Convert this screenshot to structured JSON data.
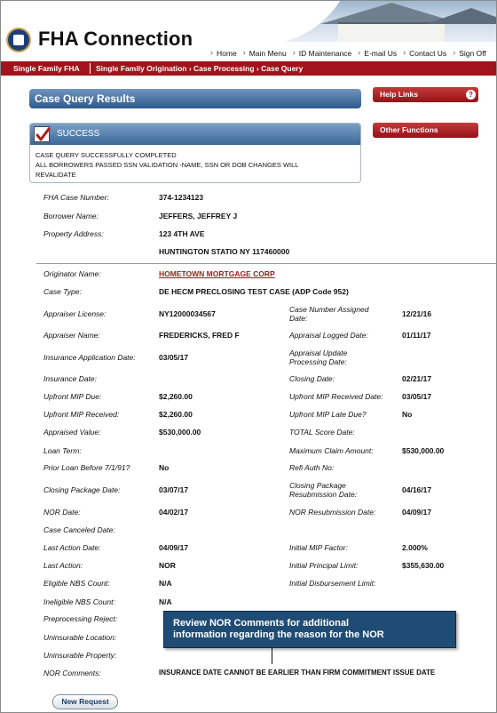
{
  "header": {
    "brand": "FHA Connection",
    "nav": [
      "Home",
      "Main Menu",
      "ID Maintenance",
      "E-mail Us",
      "Contact Us",
      "Sign Off"
    ]
  },
  "redbar": {
    "section": "Single Family FHA",
    "breadcrumb": "Single Family Origination › Case Processing › Case Query"
  },
  "page": {
    "title": "Case Query Results",
    "help_links": "Help Links",
    "help_icon": "?",
    "other_functions": "Other Functions"
  },
  "success": {
    "label": "SUCCESS",
    "line1": "CASE QUERY SUCCESSFULLY COMPLETED",
    "line2": "ALL BORROWERS PASSED SSN VALIDATION -NAME, SSN OR DOB CHANGES WILL",
    "line3": "REVALIDATE"
  },
  "case": {
    "fha_case_number_label": "FHA Case Number:",
    "fha_case_number": "374-1234123",
    "borrower_name_label": "Borrower Name:",
    "borrower_name": "JEFFERS, JEFFREY J",
    "property_address_label": "Property Address:",
    "property_address_1": "123 4TH AVE",
    "property_address_2": "HUNTINGTON STATIO NY 117460000"
  },
  "fields": {
    "originator_name_label": "Originator Name:",
    "originator_name": "HOMETOWN MORTGAGE CORP",
    "case_type_label": "Case Type:",
    "case_type": "DE HECM PRECLOSING TEST CASE (ADP Code 952)",
    "appraiser_license_label": "Appraiser License:",
    "appraiser_license": "NY12000034567",
    "case_number_assigned_label_1": "Case Number Assigned",
    "case_number_assigned_label_2": "Date:",
    "case_number_assigned": "12/21/16",
    "appraiser_name_label": "Appraiser Name:",
    "appraiser_name": "FREDERICKS, FRED F",
    "appraisal_logged_label": "Appraisal Logged Date:",
    "appraisal_logged": "01/11/17",
    "insurance_application_label": "Insurance Application Date:",
    "insurance_application": "03/05/17",
    "appraisal_update_label_1": "Appraisal Update",
    "appraisal_update_label_2": "Processing Date:",
    "insurance_date_label": "Insurance Date:",
    "closing_date_label": "Closing Date:",
    "closing_date": "02/21/17",
    "upfront_mip_due_label": "Upfront MIP Due:",
    "upfront_mip_due": "$2,260.00",
    "upfront_mip_received_date_label": "Upfront MIP Received Date:",
    "upfront_mip_received_date": "03/05/17",
    "upfront_mip_received_label": "Upfront MIP Received:",
    "upfront_mip_received": "$2,260.00",
    "upfront_mip_late_label": "Upfront MIP Late Due?",
    "upfront_mip_late": "No",
    "appraised_value_label": "Appraised Value:",
    "appraised_value": "$530,000.00",
    "total_score_label": "TOTAL Score Date:",
    "loan_term_label": "Loan Term:",
    "max_claim_label": "Maximum Claim Amount:",
    "max_claim": "$530,000.00",
    "prior_loan_label": "Prior Loan Before 7/1/91?",
    "prior_loan": "No",
    "refi_auth_label": "Refi Auth No:",
    "closing_package_label": "Closing Package Date:",
    "closing_package": "03/07/17",
    "closing_package_resub_label_1": "Closing Package",
    "closing_package_resub_label_2": "Resubmission Date:",
    "closing_package_resub": "04/16/17",
    "nor_date_label": "NOR Date:",
    "nor_date": "04/02/17",
    "nor_resub_label": "NOR Resubmission Date:",
    "nor_resub": "04/09/17",
    "case_canceled_label": "Case Canceled Date:",
    "last_action_date_label": "Last Action Date:",
    "last_action_date": "04/09/17",
    "initial_mip_factor_label": "Initial MIP Factor:",
    "initial_mip_factor": "2.000%",
    "last_action_label": "Last Action:",
    "last_action": "NOR",
    "initial_principal_label": "Initial Principal Limit:",
    "initial_principal": "$355,630.00",
    "eligible_nbs_label": "Eligible NBS Count:",
    "eligible_nbs": "N/A",
    "initial_disbursement_label": "Initial Disbursement Limit:",
    "ineligible_nbs_label": "Ineligible NBS Count:",
    "ineligible_nbs": "N/A",
    "preprocessing_reject_label": "Preprocessing Reject:",
    "uninsurable_location_label": "Uninsurable Location:",
    "uninsurable_property_label": "Uninsurable Property:",
    "nor_comments_label": "NOR Comments:",
    "nor_comments": "INSURANCE DATE CANNOT BE EARLIER THAN FIRM COMMITMENT ISSUE DATE"
  },
  "callout": {
    "line1": "Review NOR Comments for additional",
    "line2": "information regarding the reason for the NOR"
  },
  "buttons": {
    "new_request": "New Request"
  }
}
